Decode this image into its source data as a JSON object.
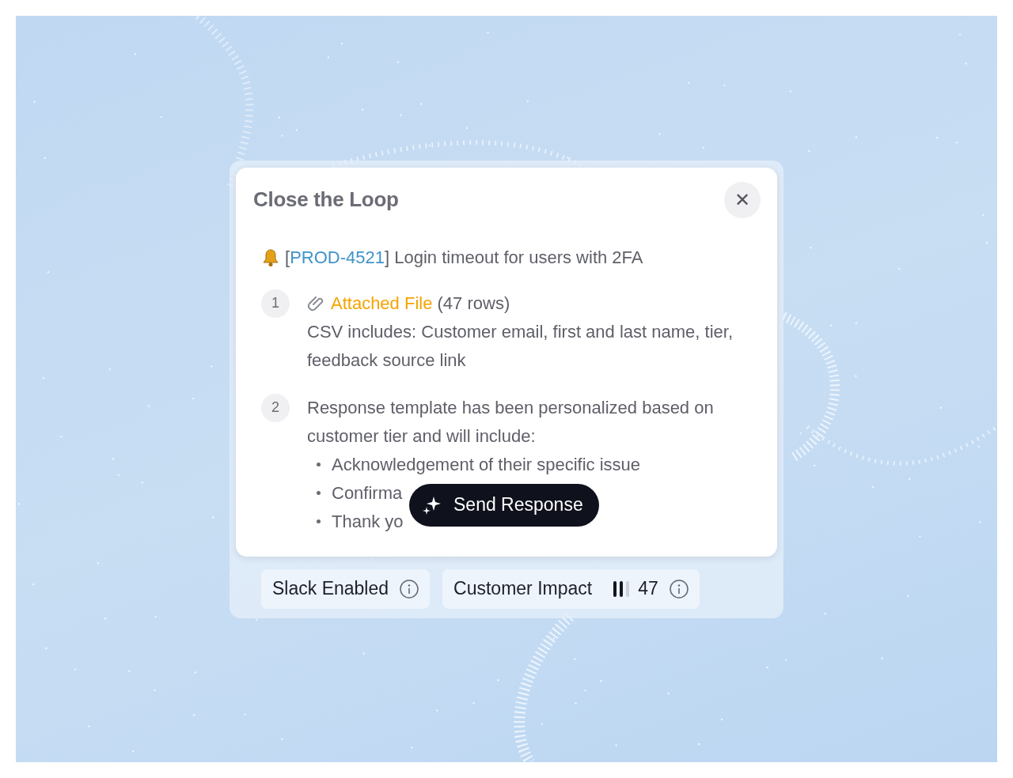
{
  "dialog": {
    "title": "Close the Loop",
    "close_label": "✕",
    "ticket": {
      "id": "PROD-4521",
      "open_bracket": "[",
      "close_bracket": "]",
      "summary": " Login timeout for users with 2FA"
    },
    "steps": [
      {
        "number": "1",
        "kind": "file",
        "link": "Attached File",
        "note": " (47 rows)",
        "text": "CSV includes: Customer email, first and last name, tier, feedback source link"
      },
      {
        "number": "2",
        "kind": "template",
        "text": "Response template has been personalized based on customer tier and will include:",
        "bullets": [
          "Acknowledgement of their specific issue",
          "Confirma",
          "Thank yo"
        ]
      }
    ],
    "action": {
      "label": "Send Response"
    }
  },
  "footer": {
    "chips": [
      {
        "kind": "plain",
        "label": "Slack Enabled"
      },
      {
        "kind": "meter",
        "label": "Customer Impact",
        "level": 0.67,
        "value": "47"
      }
    ]
  }
}
